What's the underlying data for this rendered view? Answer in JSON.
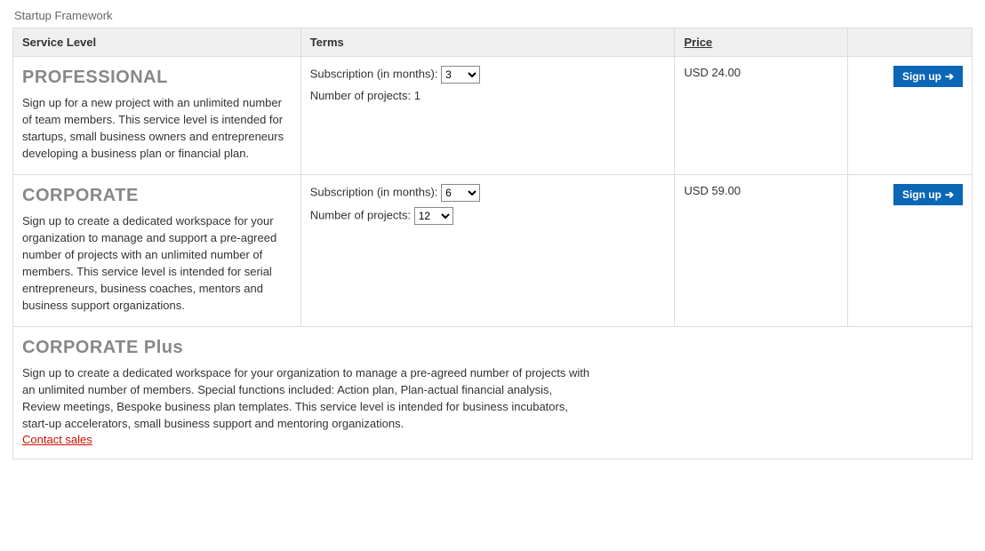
{
  "page_title": "Startup Framework",
  "columns": {
    "service": "Service Level",
    "terms": "Terms",
    "price": "Price"
  },
  "labels": {
    "subscription": "Subscription (in months):",
    "projects": "Number of projects:",
    "signup": "Sign up"
  },
  "tiers": {
    "professional": {
      "name": "PROFESSIONAL",
      "desc": "Sign up for a new project with an unlimited number of team members.\nThis service level is intended for startups, small business owners and entrepreneurs developing a business plan or financial plan.",
      "subscription_value": "3",
      "projects_value": "1",
      "price": "USD 24.00"
    },
    "corporate": {
      "name": "CORPORATE",
      "desc": "Sign up to create a dedicated workspace for your organization to manage and support a pre-agreed number of projects with an unlimited number of members.\nThis service level is intended for serial entrepreneurs, business coaches, mentors and business support organizations.",
      "subscription_value": "6",
      "projects_value": "12",
      "price": "USD 59.00"
    },
    "corporate_plus": {
      "name": "CORPORATE Plus",
      "desc": "Sign up to create a dedicated workspace for your organization to manage a pre-agreed number of projects with an unlimited number of members.\nSpecial functions included: Action plan, Plan-actual financial analysis, Review meetings, Bespoke business plan templates.\nThis service level is intended for business incubators, start-up accelerators, small business support and mentoring organizations.",
      "contact_label": "Contact sales"
    }
  }
}
